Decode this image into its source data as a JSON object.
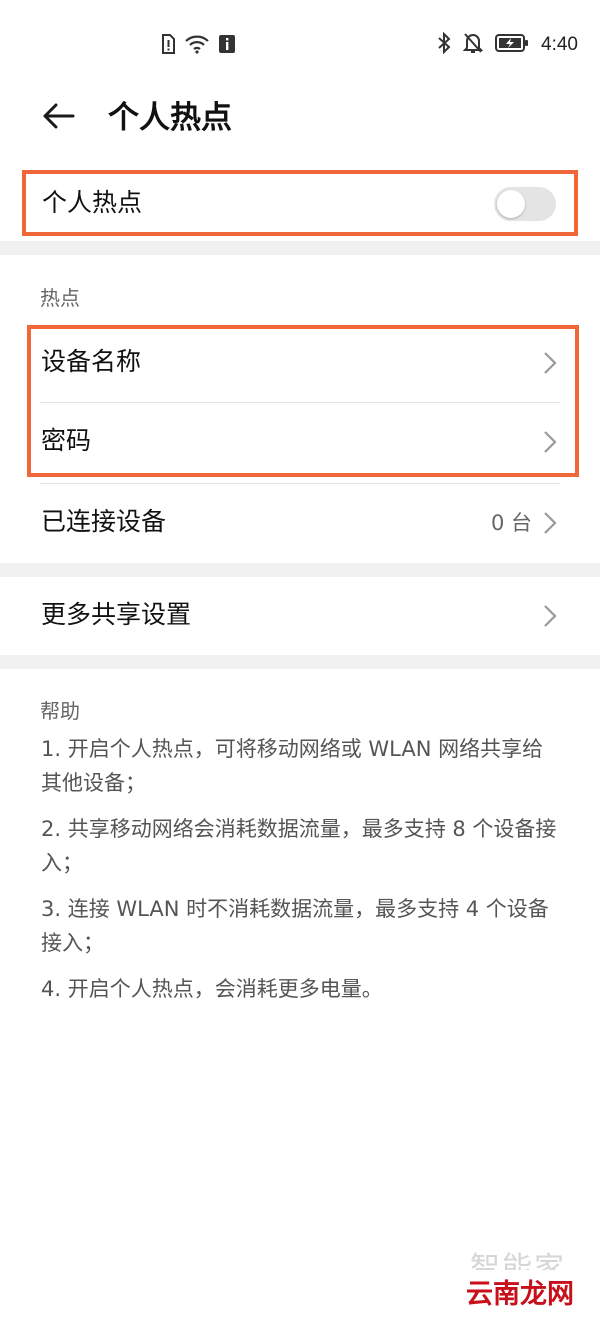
{
  "status_bar": {
    "time": "4:40",
    "left_icons": [
      "sim-alert-icon",
      "wifi-icon",
      "info-icon"
    ],
    "right_icons": [
      "bluetooth-icon",
      "mute-bell-icon",
      "battery-charging-icon"
    ]
  },
  "header": {
    "back_icon": "arrow-left-icon",
    "title": "个人热点"
  },
  "hotspot_toggle": {
    "label": "个人热点",
    "enabled": false
  },
  "hotspot_section": {
    "title": "热点",
    "items": [
      {
        "label": "设备名称"
      },
      {
        "label": "密码"
      }
    ]
  },
  "connected_devices": {
    "label": "已连接设备",
    "value": "0 台"
  },
  "more_sharing": {
    "label": "更多共享设置"
  },
  "help": {
    "title": "帮助",
    "items": [
      "1. 开启个人热点，可将移动网络或 WLAN 网络共享给其他设备；",
      "2. 共享移动网络会消耗数据流量，最多支持 8 个设备接入；",
      "3. 连接 WLAN 时不消耗数据流量，最多支持 4 个设备接入；",
      "4. 开启个人热点，会消耗更多电量。"
    ]
  },
  "watermark": {
    "top": "智能家",
    "bottom": "云南龙网"
  },
  "colors": {
    "highlight_box": "#f0683a",
    "toggle_off": "#e4e4e4",
    "watermark_red": "#c8101a"
  }
}
